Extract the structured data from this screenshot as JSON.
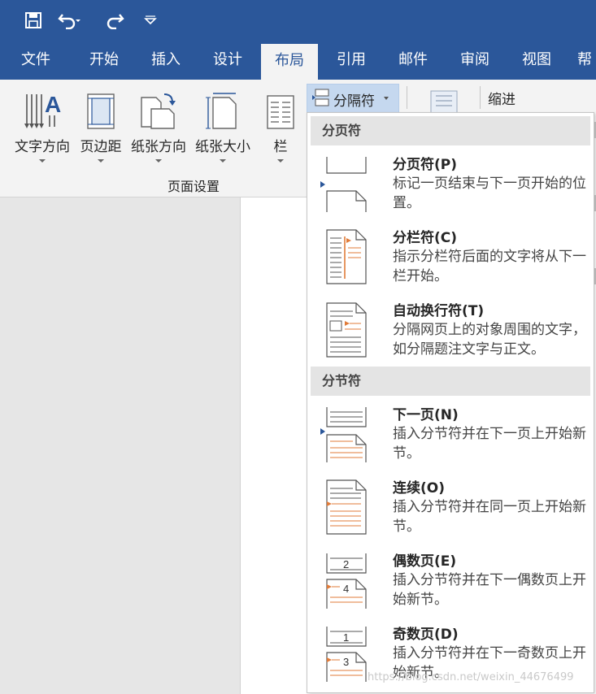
{
  "quick_access": {
    "save_icon": "save-icon",
    "undo_icon": "undo-icon",
    "redo_icon": "redo-icon",
    "customize_icon": "customize-qat-icon"
  },
  "tabs": [
    {
      "label": "文件"
    },
    {
      "label": "开始"
    },
    {
      "label": "插入"
    },
    {
      "label": "设计"
    },
    {
      "label": "布局",
      "active": true
    },
    {
      "label": "引用"
    },
    {
      "label": "邮件"
    },
    {
      "label": "审阅"
    },
    {
      "label": "视图"
    },
    {
      "label": "帮"
    }
  ],
  "ribbon": {
    "buttons": [
      {
        "label": "文字方向",
        "icon": "text-direction-icon"
      },
      {
        "label": "页边距",
        "icon": "margins-icon"
      },
      {
        "label": "纸张方向",
        "icon": "orientation-icon"
      },
      {
        "label": "纸张大小",
        "icon": "paper-size-icon"
      },
      {
        "label": "栏",
        "icon": "columns-icon"
      }
    ],
    "group_label": "页面设置",
    "breaks_label": "分隔符",
    "indent_label": "缩进"
  },
  "menu": {
    "section1": "分页符",
    "section2": "分节符",
    "items": [
      {
        "title": "分页符(P)",
        "desc": "标记一页结束与下一页开始的位置。",
        "icon": "page-break-icon"
      },
      {
        "title": "分栏符(C)",
        "desc": "指示分栏符后面的文字将从下一栏开始。",
        "icon": "column-break-icon"
      },
      {
        "title": "自动换行符(T)",
        "desc": "分隔网页上的对象周围的文字，如分隔题注文字与正文。",
        "icon": "text-wrapping-break-icon"
      },
      {
        "title": "下一页(N)",
        "desc": "插入分节符并在下一页上开始新节。",
        "icon": "next-page-section-icon"
      },
      {
        "title": "连续(O)",
        "desc": "插入分节符并在同一页上开始新节。",
        "icon": "continuous-section-icon"
      },
      {
        "title": "偶数页(E)",
        "desc": "插入分节符并在下一偶数页上开始新节。",
        "icon": "even-page-section-icon",
        "nums": [
          "2",
          "4"
        ]
      },
      {
        "title": "奇数页(D)",
        "desc": "插入分节符并在下一奇数页上开始新节。",
        "icon": "odd-page-section-icon",
        "nums": [
          "1",
          "3"
        ]
      }
    ]
  },
  "watermark": "https://blog.csdn.net/weixin_44676499",
  "colors": {
    "accent": "#2b579a",
    "highlight": "#c5d8ef",
    "break_orange": "#e07b39"
  }
}
